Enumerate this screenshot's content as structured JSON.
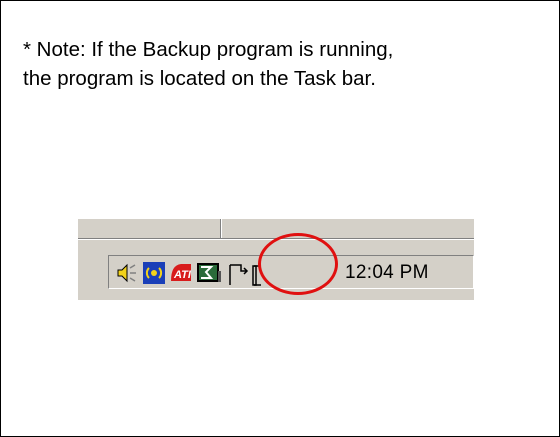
{
  "note": {
    "line1": "* Note: If the Backup program is running,",
    "line2": "the program is located on the Task bar."
  },
  "tray": {
    "clock": "12:04 PM",
    "icons": [
      "volume-icon",
      "network-icon",
      "ati-icon",
      "media-icon",
      "backup-icon"
    ]
  },
  "colors": {
    "taskbar": "#d4d0c8",
    "highlight": "#e01010",
    "ati_red": "#d81c1c",
    "network_blue": "#1a3fb8",
    "volume_yellow": "#f2d21a"
  }
}
